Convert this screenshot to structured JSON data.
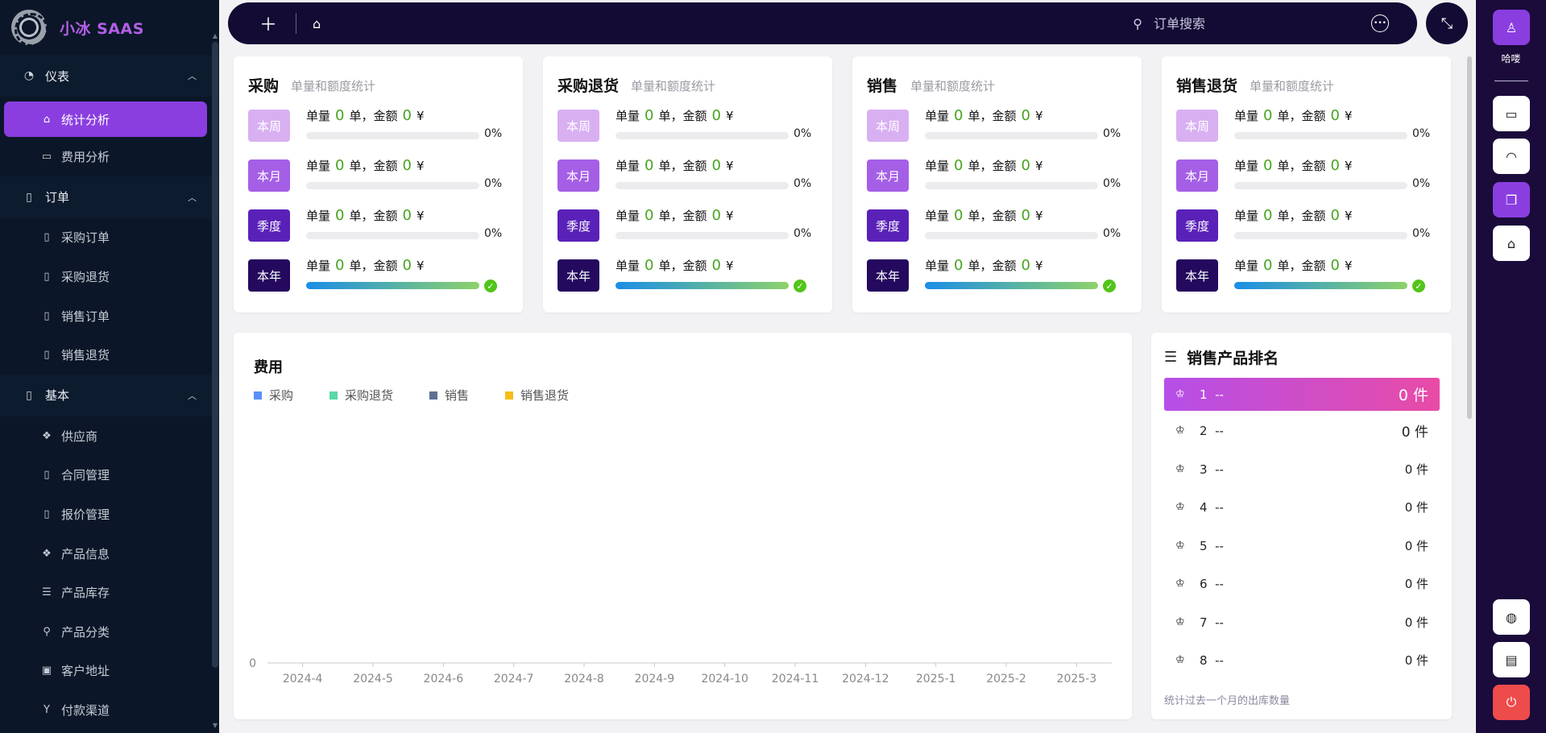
{
  "brand": {
    "title": "小冰 SAAS"
  },
  "sidebar": {
    "groups": [
      {
        "label": "仪表",
        "icon": "dashboard-icon",
        "items": [
          {
            "label": "统计分析",
            "icon": "home-icon",
            "active": true
          },
          {
            "label": "费用分析",
            "icon": "monitor-chart-icon"
          }
        ]
      },
      {
        "label": "订单",
        "icon": "clipboard-icon",
        "items": [
          {
            "label": "采购订单",
            "icon": "doc-edit-icon"
          },
          {
            "label": "采购退货",
            "icon": "doc-return-icon"
          },
          {
            "label": "销售订单",
            "icon": "doc-icon"
          },
          {
            "label": "销售退货",
            "icon": "doc-blank-icon"
          }
        ]
      },
      {
        "label": "基本",
        "icon": "file-icon",
        "items": [
          {
            "label": "供应商",
            "icon": "dropbox-icon"
          },
          {
            "label": "合同管理",
            "icon": "contract-icon"
          },
          {
            "label": "报价管理",
            "icon": "quote-icon"
          },
          {
            "label": "产品信息",
            "icon": "dropbox-icon"
          },
          {
            "label": "产品库存",
            "icon": "list-doc-icon"
          },
          {
            "label": "产品分类",
            "icon": "hierarchy-icon"
          },
          {
            "label": "客户地址",
            "icon": "address-icon"
          },
          {
            "label": "付款渠道",
            "icon": "payment-icon"
          }
        ]
      }
    ]
  },
  "topbar": {
    "search_placeholder": "订单搜索"
  },
  "rail": {
    "user_name": "哈喽"
  },
  "stats": {
    "subtitle": "单量和额度统计",
    "text_prefix": "单量",
    "text_middle": "单，金额",
    "currency": "¥",
    "cards": [
      {
        "title": "采购",
        "rows": [
          {
            "label": "本周",
            "count": "0",
            "amount": "0",
            "pct": "0%",
            "progress": 0
          },
          {
            "label": "本月",
            "count": "0",
            "amount": "0",
            "pct": "0%",
            "progress": 0
          },
          {
            "label": "季度",
            "count": "0",
            "amount": "0",
            "pct": "0%",
            "progress": 0
          },
          {
            "label": "本年",
            "count": "0",
            "amount": "0",
            "pct": "",
            "progress": 100,
            "done": true
          }
        ]
      },
      {
        "title": "采购退货",
        "rows": [
          {
            "label": "本周",
            "count": "0",
            "amount": "0",
            "pct": "0%",
            "progress": 0
          },
          {
            "label": "本月",
            "count": "0",
            "amount": "0",
            "pct": "0%",
            "progress": 0
          },
          {
            "label": "季度",
            "count": "0",
            "amount": "0",
            "pct": "0%",
            "progress": 0
          },
          {
            "label": "本年",
            "count": "0",
            "amount": "0",
            "pct": "",
            "progress": 100,
            "done": true
          }
        ]
      },
      {
        "title": "销售",
        "rows": [
          {
            "label": "本周",
            "count": "0",
            "amount": "0",
            "pct": "0%",
            "progress": 0
          },
          {
            "label": "本月",
            "count": "0",
            "amount": "0",
            "pct": "0%",
            "progress": 0
          },
          {
            "label": "季度",
            "count": "0",
            "amount": "0",
            "pct": "0%",
            "progress": 0
          },
          {
            "label": "本年",
            "count": "0",
            "amount": "0",
            "pct": "",
            "progress": 100,
            "done": true
          }
        ]
      },
      {
        "title": "销售退货",
        "rows": [
          {
            "label": "本周",
            "count": "0",
            "amount": "0",
            "pct": "0%",
            "progress": 0
          },
          {
            "label": "本月",
            "count": "0",
            "amount": "0",
            "pct": "0%",
            "progress": 0
          },
          {
            "label": "季度",
            "count": "0",
            "amount": "0",
            "pct": "0%",
            "progress": 0
          },
          {
            "label": "本年",
            "count": "0",
            "amount": "0",
            "pct": "",
            "progress": 100,
            "done": true
          }
        ]
      }
    ],
    "badge_colors": [
      "#d8b0f2",
      "#a55fe6",
      "#5a21b8",
      "#24095e"
    ]
  },
  "expense": {
    "title": "费用",
    "legend": [
      {
        "name": "采购",
        "color": "#5b8ff9"
      },
      {
        "name": "采购退货",
        "color": "#5ad8a6"
      },
      {
        "name": "销售",
        "color": "#5d7092"
      },
      {
        "name": "销售退货",
        "color": "#f6bd16"
      }
    ]
  },
  "chart_data": {
    "type": "line",
    "title": "费用",
    "x": [
      "2024-4",
      "2024-5",
      "2024-6",
      "2024-7",
      "2024-8",
      "2024-9",
      "2024-10",
      "2024-11",
      "2024-12",
      "2025-1",
      "2025-2",
      "2025-3"
    ],
    "series": [
      {
        "name": "采购",
        "values": [
          0,
          0,
          0,
          0,
          0,
          0,
          0,
          0,
          0,
          0,
          0,
          0
        ]
      },
      {
        "name": "采购退货",
        "values": [
          0,
          0,
          0,
          0,
          0,
          0,
          0,
          0,
          0,
          0,
          0,
          0
        ]
      },
      {
        "name": "销售",
        "values": [
          0,
          0,
          0,
          0,
          0,
          0,
          0,
          0,
          0,
          0,
          0,
          0
        ]
      },
      {
        "name": "销售退货",
        "values": [
          0,
          0,
          0,
          0,
          0,
          0,
          0,
          0,
          0,
          0,
          0,
          0
        ]
      }
    ],
    "y_ticks": [
      "0"
    ],
    "ylim": [
      0,
      0
    ],
    "legend_position": "top-left",
    "grid": false
  },
  "ranking": {
    "title": "销售产品排名",
    "rows": [
      {
        "rank": "1",
        "name": "--",
        "qty": "0 件"
      },
      {
        "rank": "2",
        "name": "--",
        "qty": "0 件"
      },
      {
        "rank": "3",
        "name": "--",
        "qty": "0 件"
      },
      {
        "rank": "4",
        "name": "--",
        "qty": "0 件"
      },
      {
        "rank": "5",
        "name": "--",
        "qty": "0 件"
      },
      {
        "rank": "6",
        "name": "--",
        "qty": "0 件"
      },
      {
        "rank": "7",
        "name": "--",
        "qty": "0 件"
      },
      {
        "rank": "8",
        "name": "--",
        "qty": "0 件"
      }
    ],
    "footnote": "统计过去一个月的出库数量"
  }
}
